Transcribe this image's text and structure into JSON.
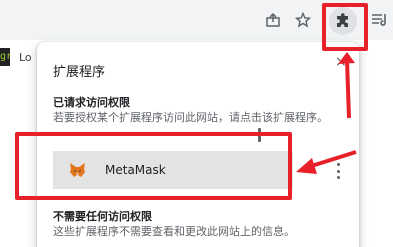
{
  "toolbar": {
    "icons": [
      "share-icon",
      "star-icon",
      "puzzle-icon",
      "queue-icon"
    ]
  },
  "page": {
    "partial_text": "Lo",
    "thumb_text": "gr"
  },
  "popup": {
    "title": "扩展程序",
    "close_label": "×",
    "section_requested": {
      "title": "已请求访问权限",
      "description": "若要授权某个扩展程序访问此网站，请点击该扩展程序。"
    },
    "extensions": [
      {
        "name": "MetaMask",
        "icon": "metamask-fox-icon"
      }
    ],
    "section_none": {
      "title": "不需要任何访问权限",
      "description": "这些扩展程序不需要查看和更改此网站上的信息。"
    }
  },
  "colors": {
    "annotation": "#e8202a",
    "toolbar_bg": "#f1f3f4",
    "row_bg": "#e3e3e3"
  }
}
